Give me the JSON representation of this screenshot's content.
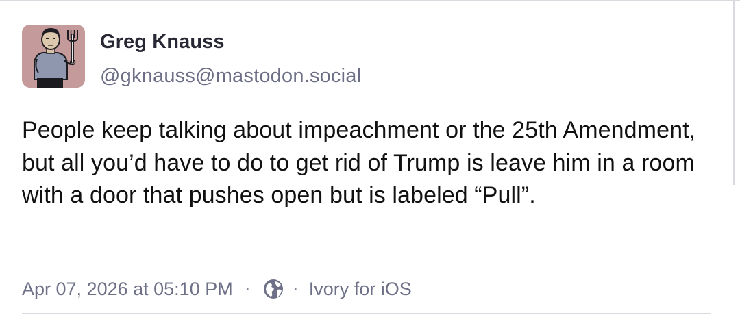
{
  "post": {
    "author": {
      "display_name": "Greg Knauss",
      "handle": "@gknauss@mastodon.social",
      "avatar_icon": "cartoon-man-with-fork-avatar",
      "avatar_bg": "#c49a9a"
    },
    "text": "People keep talking about impeachment or the 25th Amendment, but all you’d have to do to get rid of Trump is leave him in a room with a door that pushes open but is labeled “Pull”.",
    "timestamp": "Apr 07, 2026 at 05:10 PM",
    "separator": "·",
    "visibility_icon": "globe-icon",
    "client": "Ivory for iOS"
  },
  "colors": {
    "name": "#272833",
    "handle": "#6b6e85",
    "body_text": "#111111",
    "meta_text": "#6d7087",
    "border": "#d9d9e0"
  }
}
